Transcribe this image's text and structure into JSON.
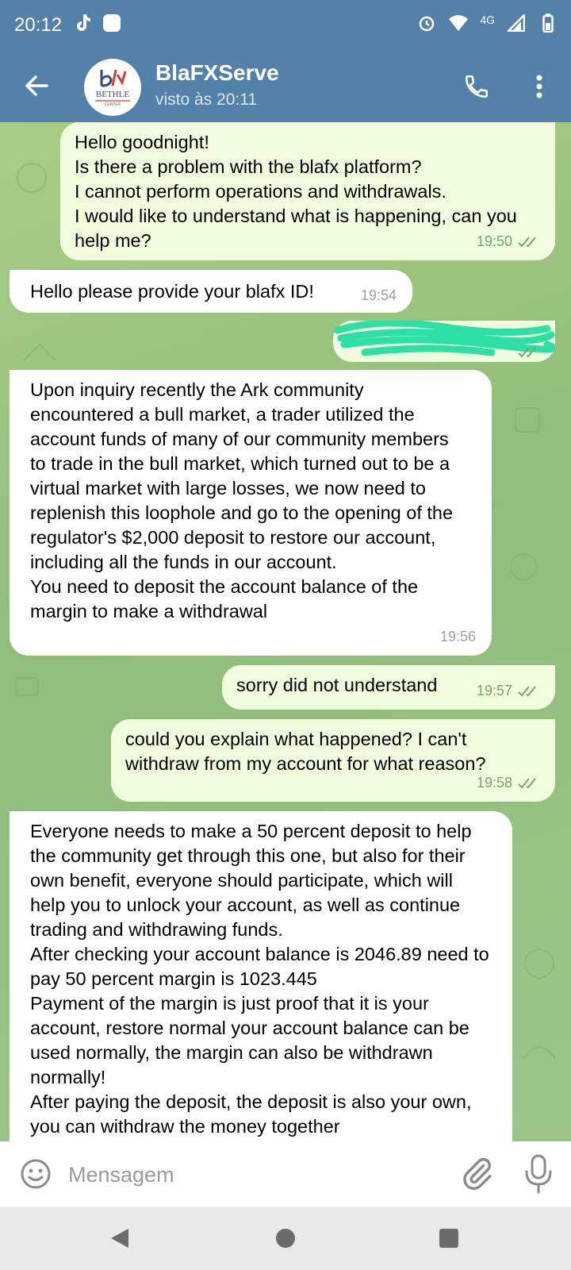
{
  "status_bar": {
    "time": "20:12",
    "network": "4G",
    "icons": [
      "tiktok-icon",
      "app-notification-icon",
      "alarm-icon",
      "wifi-icon",
      "signal-icon",
      "battery-icon"
    ]
  },
  "header": {
    "chat_name": "BlaFXServe",
    "chat_status": "visto às 20:11",
    "avatar_text": "BETHLE",
    "avatar_subtext": "CENTER"
  },
  "colors": {
    "header_bg": "#5481a8",
    "outgoing_bubble": "#effdde",
    "incoming_bubble": "#ffffff",
    "read_checks": "#79a46a"
  },
  "messages": [
    {
      "id": "m1",
      "direction": "out",
      "text": "Hello goodnight!\nIs there a problem with the blafx platform?\nI cannot perform operations and withdrawals.\nI would like to understand what is happening, can you help me?",
      "time": "19:50",
      "read": true
    },
    {
      "id": "m2",
      "direction": "in",
      "text": "Hello please provide your blafx ID!",
      "time": "19:54"
    },
    {
      "id": "m3",
      "direction": "out",
      "text": "",
      "time": "",
      "redacted": true,
      "read": true
    },
    {
      "id": "m4",
      "direction": "in",
      "text": "Upon inquiry recently the Ark community encountered a bull market, a trader utilized the account funds of many of our community members to trade in the bull market, which turned out to be a virtual market with large losses, we now need to replenish this loophole and go to the opening of the regulator's $2,000 deposit to restore our account, including all the funds in our account.\nYou need to deposit the account balance of the margin to make a withdrawal",
      "time": "19:56"
    },
    {
      "id": "m5",
      "direction": "out",
      "text": "sorry did not understand",
      "time": "19:57",
      "read": true
    },
    {
      "id": "m6",
      "direction": "out",
      "text": "could you explain what happened? I can't withdraw from my account for what reason?",
      "time": "19:58",
      "read": true
    },
    {
      "id": "m7",
      "direction": "in",
      "text": "Everyone needs to make a 50 percent deposit to help the community get through this one, but also for their own benefit, everyone should participate, which will help you to unlock your account, as well as continue trading and withdrawing funds.\nAfter checking your account balance is 2046.89 need to pay 50 percent margin is 1023.445\nPayment of the margin is just proof that it is your account, restore normal your account balance can be used normally, the margin can also be withdrawn normally!\nAfter paying the deposit, the deposit is also your own, you can withdraw the money together",
      "time": ""
    }
  ],
  "composer": {
    "placeholder": "Mensagem"
  },
  "navbar": {
    "buttons": [
      "back-triangle",
      "home-circle",
      "recents-square"
    ]
  }
}
